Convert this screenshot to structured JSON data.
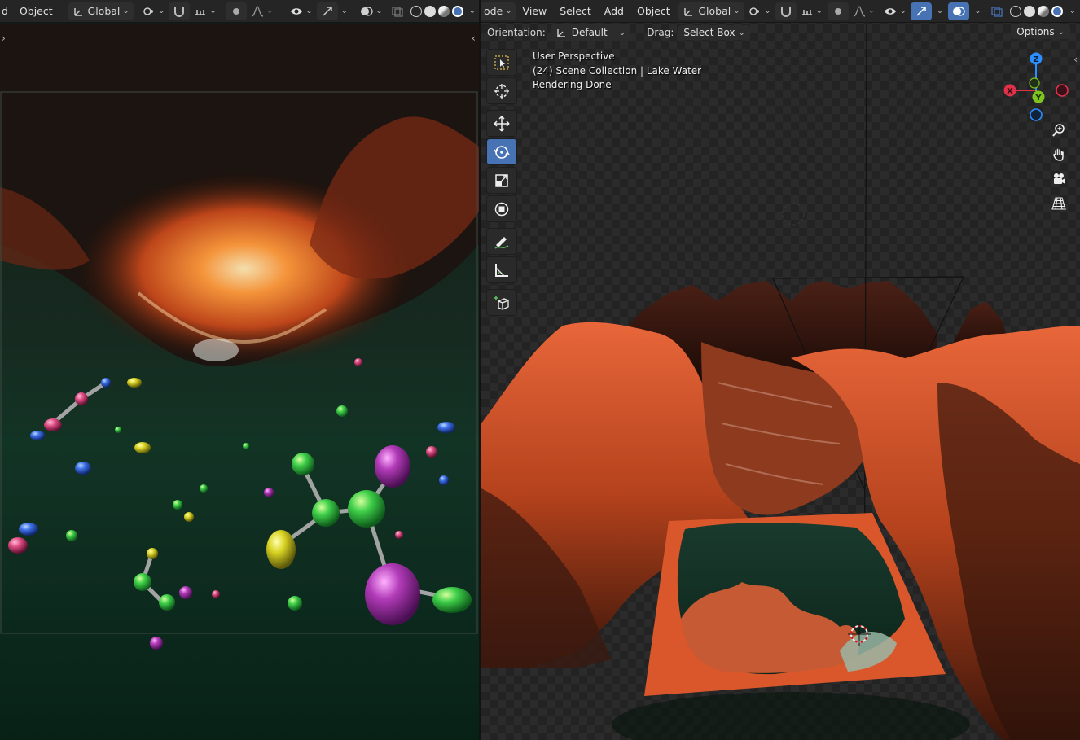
{
  "left_header": {
    "mode_fragment": "d",
    "object_menu": "Object",
    "orientation": "Global"
  },
  "right_header": {
    "mode_fragment": "ode",
    "menus": [
      "View",
      "Select",
      "Add",
      "Object"
    ],
    "orientation": "Global"
  },
  "tool_settings": {
    "orientation_label": "Orientation:",
    "orientation_value": "Default",
    "drag_label": "Drag:",
    "drag_value": "Select Box",
    "options": "Options"
  },
  "viewport_info": {
    "perspective": "User Perspective",
    "collection": "(24) Scene Collection | Lake Water",
    "status": "Rendering Done"
  },
  "gizmo": {
    "x": "X",
    "y": "Y",
    "z": "Z"
  },
  "toolbar_tools": [
    {
      "name": "select-box",
      "icon": "select-box-icon"
    },
    {
      "name": "cursor",
      "icon": "cursor-icon"
    },
    {
      "name": "move",
      "icon": "move-icon"
    },
    {
      "name": "rotate",
      "icon": "rotate-icon",
      "active": true
    },
    {
      "name": "scale",
      "icon": "scale-icon"
    },
    {
      "name": "transform",
      "icon": "transform-icon"
    },
    {
      "name": "annotate",
      "icon": "annotate-icon"
    },
    {
      "name": "measure",
      "icon": "measure-icon"
    },
    {
      "name": "add-cube",
      "icon": "add-cube-icon"
    }
  ],
  "colors": {
    "accent": "#4772b3",
    "header_bg": "#252525",
    "terrain": "#d9572b",
    "axis_x": "#e0314b",
    "axis_y": "#7ec51f",
    "axis_z": "#2c8fff"
  }
}
